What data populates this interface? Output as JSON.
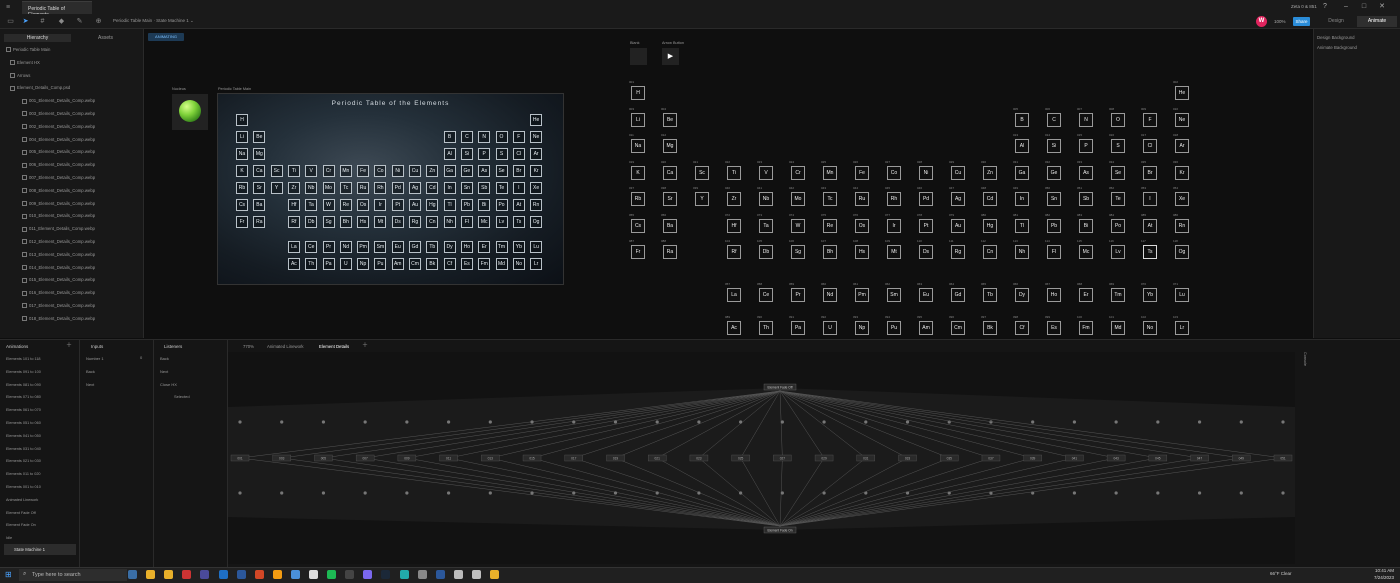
{
  "window": {
    "tab_title": "Periodic Table of Elements",
    "account": "Zeta 0 & 851"
  },
  "toolbar": {
    "breadcrumb": "Periodic Table Main · State Machine 1 ⌄",
    "avatar_letter": "W",
    "zoom": "100%",
    "share_label": "Share",
    "mode_design": "Design",
    "mode_animate": "Animate"
  },
  "left_panel": {
    "tab_hierarchy": "Hierarchy",
    "tab_assets": "Assets",
    "items": [
      "Periodic Table Main",
      "Element HX",
      "Arrows",
      "Element_Details_Comp.psd",
      "001_Element_Details_Comp.webp",
      "003_Element_Details_Comp.webp",
      "002_Element_Details_Comp.webp",
      "004_Element_Details_Comp.webp",
      "005_Element_Details_Comp.webp",
      "006_Element_Details_Comp.webp",
      "007_Element_Details_Comp.webp",
      "008_Element_Details_Comp.webp",
      "009_Element_Details_Comp.webp",
      "010_Element_Details_Comp.webp",
      "011_Element_Details_Comp.webp",
      "012_Element_Details_Comp.webp",
      "013_Element_Details_Comp.webp",
      "014_Element_Details_Comp.webp",
      "015_Element_Details_Comp.webp",
      "016_Element_Details_Comp.webp",
      "017_Element_Details_Comp.webp",
      "018_Element_Details_Comp.webp"
    ]
  },
  "stage": {
    "animating_badge": "ANIMATING",
    "nucleus_label": "Nucleus",
    "artboard_label": "Periodic Table Main",
    "artboard_title": "Periodic Table of the Elements",
    "blank_label": "Blank",
    "arrow_button_label": "Arrow Button",
    "arrow_glyph": "▶"
  },
  "mini_table": {
    "rows": [
      [
        "H",
        "",
        "",
        "",
        "",
        "",
        "",
        "",
        "",
        "",
        "",
        "",
        "",
        "",
        "",
        "",
        "",
        "He"
      ],
      [
        "Li",
        "Be",
        "",
        "",
        "",
        "",
        "",
        "",
        "",
        "",
        "",
        "",
        "B",
        "C",
        "N",
        "O",
        "F",
        "Ne"
      ],
      [
        "Na",
        "Mg",
        "",
        "",
        "",
        "",
        "",
        "",
        "",
        "",
        "",
        "",
        "Al",
        "Si",
        "P",
        "S",
        "Cl",
        "Ar"
      ],
      [
        "K",
        "Ca",
        "Sc",
        "Ti",
        "V",
        "Cr",
        "Mn",
        "Fe",
        "Co",
        "Ni",
        "Cu",
        "Zn",
        "Ga",
        "Ge",
        "As",
        "Se",
        "Br",
        "Kr"
      ],
      [
        "Rb",
        "Sr",
        "Y",
        "Zr",
        "Nb",
        "Mo",
        "Tc",
        "Ru",
        "Rh",
        "Pd",
        "Ag",
        "Cd",
        "In",
        "Sn",
        "Sb",
        "Te",
        "I",
        "Xe"
      ],
      [
        "Cs",
        "Ba",
        "",
        "Hf",
        "Ta",
        "W",
        "Re",
        "Os",
        "Ir",
        "Pt",
        "Au",
        "Hg",
        "Tl",
        "Pb",
        "Bi",
        "Po",
        "At",
        "Rn"
      ],
      [
        "Fr",
        "Ra",
        "",
        "Rf",
        "Db",
        "Sg",
        "Bh",
        "Hs",
        "Mt",
        "Ds",
        "Rg",
        "Cn",
        "Nh",
        "Fl",
        "Mc",
        "Lv",
        "Ts",
        "Og"
      ]
    ],
    "lanthanides": [
      "La",
      "Ce",
      "Pr",
      "Nd",
      "Pm",
      "Sm",
      "Eu",
      "Gd",
      "Tb",
      "Dy",
      "Ho",
      "Er",
      "Tm",
      "Yb",
      "Lu"
    ],
    "actinides": [
      "Ac",
      "Th",
      "Pa",
      "U",
      "Np",
      "Pu",
      "Am",
      "Cm",
      "Bk",
      "Cf",
      "Es",
      "Fm",
      "Md",
      "No",
      "Lr"
    ]
  },
  "element_grid": {
    "rows": [
      [
        "H",
        "",
        "",
        "",
        "",
        "",
        "",
        "",
        "",
        "",
        "",
        "",
        "",
        "",
        "",
        "",
        "",
        "He"
      ],
      [
        "Li",
        "Be",
        "",
        "",
        "",
        "",
        "",
        "",
        "",
        "",
        "",
        "",
        "B",
        "C",
        "N",
        "O",
        "F",
        "Ne"
      ],
      [
        "Na",
        "Mg",
        "",
        "",
        "",
        "",
        "",
        "",
        "",
        "",
        "",
        "",
        "Al",
        "Si",
        "P",
        "S",
        "Cl",
        "Ar"
      ],
      [
        "K",
        "Ca",
        "Sc",
        "Ti",
        "V",
        "Cr",
        "Mn",
        "Fe",
        "Co",
        "Ni",
        "Cu",
        "Zn",
        "Ga",
        "Ge",
        "As",
        "Se",
        "Br",
        "Kr"
      ],
      [
        "Rb",
        "Sr",
        "Y",
        "Zr",
        "Nb",
        "Mo",
        "Tc",
        "Ru",
        "Rh",
        "Pd",
        "Ag",
        "Cd",
        "In",
        "Sn",
        "Sb",
        "Te",
        "I",
        "Xe"
      ],
      [
        "Cs",
        "Ba",
        "",
        "Hf",
        "Ta",
        "W",
        "Re",
        "Os",
        "Ir",
        "Pt",
        "Au",
        "Hg",
        "Tl",
        "Pb",
        "Bi",
        "Po",
        "At",
        "Rn"
      ],
      [
        "Fr",
        "Ra",
        "",
        "Rf",
        "Db",
        "Sg",
        "Bh",
        "Hs",
        "Mt",
        "Ds",
        "Rg",
        "Cn",
        "Nh",
        "Fl",
        "Mc",
        "Lv",
        "Ts",
        "Og"
      ]
    ],
    "row_numbers": [
      [
        "001",
        "",
        "",
        "",
        "",
        "",
        "",
        "",
        "",
        "",
        "",
        "",
        "",
        "",
        "",
        "",
        "",
        "002"
      ],
      [
        "003",
        "004",
        "",
        "",
        "",
        "",
        "",
        "",
        "",
        "",
        "",
        "",
        "005",
        "006",
        "007",
        "008",
        "009",
        "010"
      ],
      [
        "011",
        "012",
        "",
        "",
        "",
        "",
        "",
        "",
        "",
        "",
        "",
        "",
        "013",
        "014",
        "015",
        "016",
        "017",
        "018"
      ],
      [
        "019",
        "020",
        "021",
        "022",
        "023",
        "024",
        "025",
        "026",
        "027",
        "028",
        "029",
        "030",
        "031",
        "032",
        "033",
        "034",
        "035",
        "036"
      ],
      [
        "037",
        "038",
        "039",
        "040",
        "041",
        "042",
        "043",
        "044",
        "045",
        "046",
        "047",
        "048",
        "049",
        "050",
        "051",
        "052",
        "053",
        "054"
      ],
      [
        "055",
        "056",
        "",
        "072",
        "073",
        "074",
        "075",
        "076",
        "077",
        "078",
        "079",
        "080",
        "081",
        "082",
        "083",
        "084",
        "085",
        "086"
      ],
      [
        "087",
        "088",
        "",
        "104",
        "105",
        "106",
        "107",
        "108",
        "109",
        "110",
        "111",
        "112",
        "113",
        "114",
        "115",
        "116",
        "117",
        "118"
      ]
    ],
    "lanthanides": [
      "La",
      "Ce",
      "Pr",
      "Nd",
      "Pm",
      "Sm",
      "Eu",
      "Gd",
      "Tb",
      "Dy",
      "Ho",
      "Er",
      "Tm",
      "Yb",
      "Lu"
    ],
    "lanthanide_numbers": [
      "057",
      "058",
      "059",
      "060",
      "061",
      "062",
      "063",
      "064",
      "065",
      "066",
      "067",
      "068",
      "069",
      "070",
      "071"
    ],
    "actinides": [
      "Ac",
      "Th",
      "Pa",
      "U",
      "Np",
      "Pu",
      "Am",
      "Cm",
      "Bk",
      "Cf",
      "Es",
      "Fm",
      "Md",
      "No",
      "Lr"
    ],
    "actinide_numbers": [
      "089",
      "090",
      "091",
      "092",
      "093",
      "094",
      "095",
      "096",
      "097",
      "098",
      "099",
      "100",
      "101",
      "102",
      "103"
    ]
  },
  "right_panel": {
    "design_background": "Design Background",
    "animate_background": "Animate Background"
  },
  "animations": {
    "header": "Animations",
    "items": [
      "Elements 101 to 118",
      "Elements 091 to 100",
      "Elements 081 to 090",
      "Elements 071 to 080",
      "Elements 061 to 070",
      "Elements 051 to 060",
      "Elements 041 to 050",
      "Elements 031 to 040",
      "Elements 021 to 030",
      "Elements 011 to 020",
      "Elements 001 to 010",
      "Animated Linework",
      "Element Fade Off",
      "Element Fade On",
      "Idle"
    ],
    "state_machine": "State Machine 1"
  },
  "inputs": {
    "header": "Inputs",
    "items": [
      "Number 1",
      "Back",
      "Next"
    ],
    "number_value": "0"
  },
  "listeners": {
    "header": "Listeners",
    "items": [
      "Back",
      "Next",
      "Close HX",
      "Selected"
    ]
  },
  "graph": {
    "tabs": [
      "770%",
      "Animated Linework",
      "Element Details"
    ],
    "top_node": "Element Fade Off",
    "bottom_node": "Element Fade On",
    "mid_nodes": [
      "001",
      "003",
      "005",
      "007",
      "009",
      "011",
      "013",
      "015",
      "017",
      "019",
      "021",
      "023",
      "025",
      "027",
      "029",
      "031",
      "033",
      "035",
      "037",
      "039",
      "041",
      "043",
      "045",
      "047",
      "049",
      "051"
    ],
    "side_label": "Console"
  },
  "taskbar": {
    "search_placeholder": "Type here to search",
    "weather": "66°F Clear",
    "time": "10:41 AM",
    "date": "7/24/2023"
  }
}
